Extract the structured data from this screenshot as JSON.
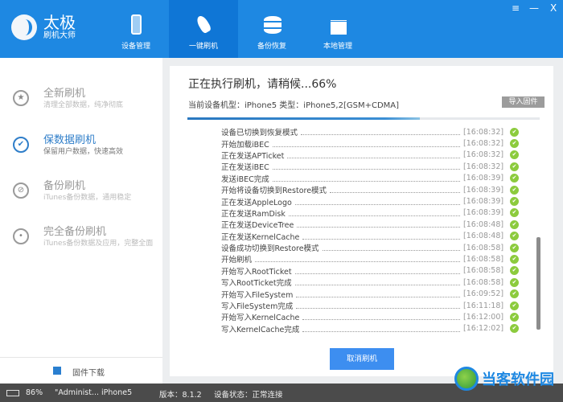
{
  "app": {
    "logo_title": "太极",
    "logo_subtitle": "刷机大师"
  },
  "nav": [
    {
      "label": "设备管理"
    },
    {
      "label": "一键刷机"
    },
    {
      "label": "备份恢复"
    },
    {
      "label": "本地管理"
    }
  ],
  "window_controls": {
    "menu": "≡",
    "minimize": "—",
    "close": "X"
  },
  "sidebar": {
    "items": [
      {
        "title": "全新刷机",
        "sub": "清理全部数据，纯净彻底",
        "icon": "★"
      },
      {
        "title": "保数据刷机",
        "sub": "保留用户数据，快速高效",
        "icon": "✔"
      },
      {
        "title": "备份刷机",
        "sub": "iTunes备份数据，通用稳定",
        "icon": "⊘"
      },
      {
        "title": "完全备份刷机",
        "sub": "iTunes备份数据及应用，完整全面",
        "icon": "•"
      }
    ],
    "firmware_download": "固件下载"
  },
  "main": {
    "title": "正在执行刷机，请稍候...66%",
    "device": "当前设备机型：iPhone5 类型：iPhone5,2[GSM+CDMA]",
    "import_button": "导入固件",
    "progress": 66,
    "cancel_button": "取消刷机",
    "log": [
      {
        "msg": "设备已切换到恢复模式",
        "time": "[16:08:32]"
      },
      {
        "msg": "开始加载iBEC",
        "time": "[16:08:32]"
      },
      {
        "msg": "正在发送APTicket",
        "time": "[16:08:32]"
      },
      {
        "msg": "正在发送iBEC",
        "time": "[16:08:32]"
      },
      {
        "msg": "发送iBEC完成",
        "time": "[16:08:39]"
      },
      {
        "msg": "开始将设备切换到Restore模式",
        "time": "[16:08:39]"
      },
      {
        "msg": "正在发送AppleLogo",
        "time": "[16:08:39]"
      },
      {
        "msg": "正在发送RamDisk",
        "time": "[16:08:39]"
      },
      {
        "msg": "正在发送DeviceTree",
        "time": "[16:08:48]"
      },
      {
        "msg": "正在发送KernelCache",
        "time": "[16:08:48]"
      },
      {
        "msg": "设备成功切换到Restore模式",
        "time": "[16:08:58]"
      },
      {
        "msg": "开始刷机",
        "time": "[16:08:58]"
      },
      {
        "msg": "开始写入RootTicket",
        "time": "[16:08:58]"
      },
      {
        "msg": "写入RootTicket完成",
        "time": "[16:08:58]"
      },
      {
        "msg": "开始写入FileSystem",
        "time": "[16:09:52]"
      },
      {
        "msg": "写入FileSystem完成",
        "time": "[16:11:18]"
      },
      {
        "msg": "开始写入KernelCache",
        "time": "[16:12:00]"
      },
      {
        "msg": "写入KernelCache完成",
        "time": "[16:12:02]"
      }
    ]
  },
  "status": {
    "battery": "86%",
    "device_name": "\"Administ... iPhone5",
    "version": "版本：8.1.2",
    "device_state": "设备状态：正常连接"
  },
  "watermark": "当客软件园"
}
